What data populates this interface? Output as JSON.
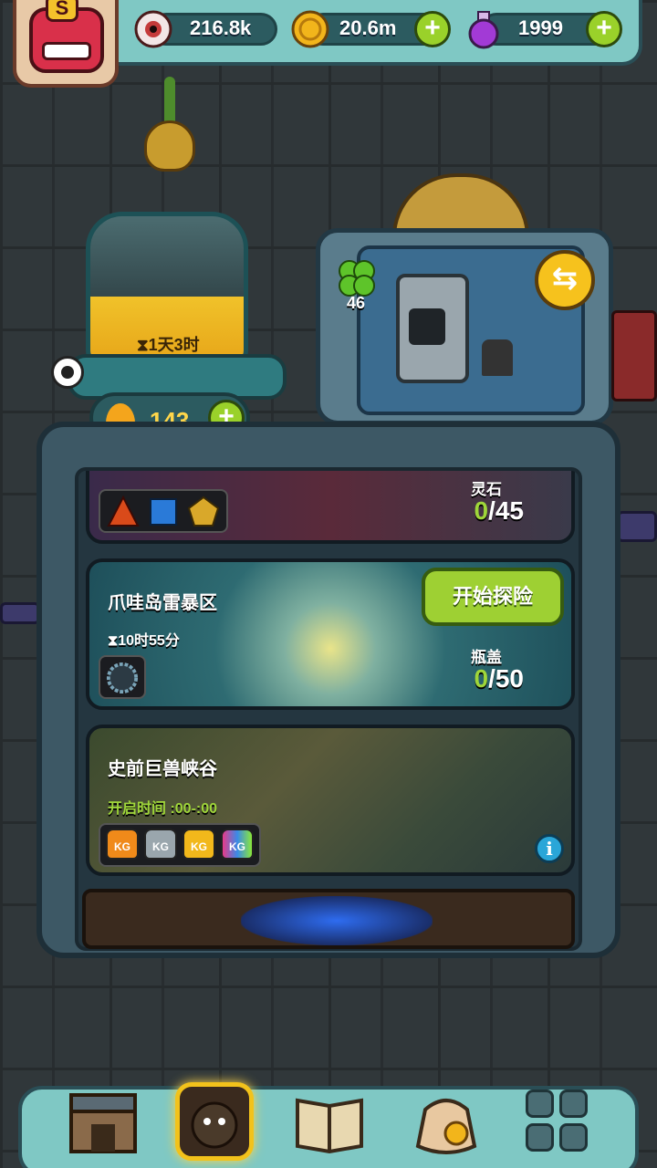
{
  "resources": {
    "eyeballs": "216.8k",
    "coins": "20.6m",
    "potions": "1999"
  },
  "avatar": {
    "rank_letter": "S"
  },
  "jar": {
    "timer": "⧗1天3时"
  },
  "oil": {
    "value": "143"
  },
  "machine": {
    "clover_count": "46",
    "swap_symbol": "⇆"
  },
  "cards": [
    {
      "title": "",
      "resource_label": "灵石",
      "current": "0",
      "total": "/45"
    },
    {
      "title": "爪哇岛雷暴区",
      "timer": "⧗10时55分",
      "resource_label": "瓶盖",
      "current": "0",
      "total": "/50",
      "start_label": "开始探险"
    },
    {
      "title": "史前巨兽峡谷",
      "open_time": "开启时间 :00-:00",
      "kg_label": "KG"
    }
  ],
  "info_symbol": "i",
  "plus_symbol": "+",
  "colors": {
    "accent_green": "#9ed033",
    "panel_teal": "#7fc8c4",
    "gold": "#f6c21d"
  },
  "icons": [
    "eyeball-icon",
    "coin-icon",
    "potion-icon",
    "oil-drop-icon",
    "clover-icon",
    "swap-icon",
    "info-icon",
    "shop-icon",
    "monster-icon",
    "book-icon",
    "bag-icon",
    "grid-menu-icon"
  ]
}
